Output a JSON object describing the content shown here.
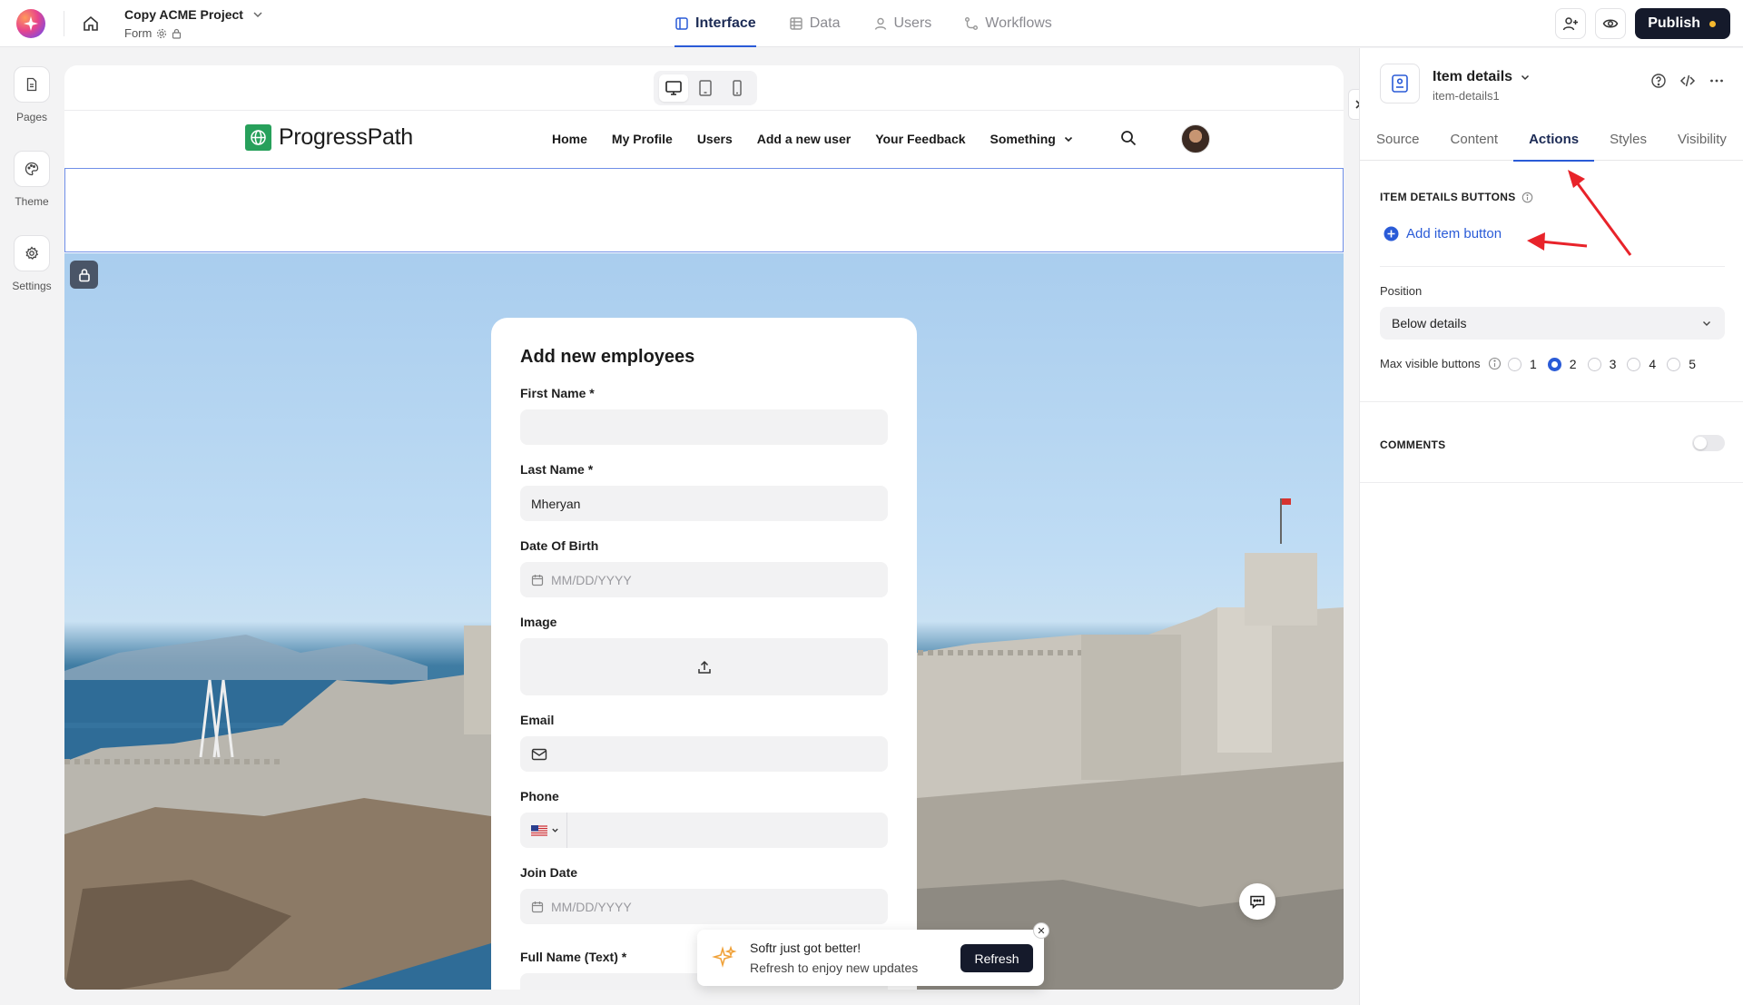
{
  "topbar": {
    "project_name": "Copy ACME Project",
    "page_name": "Form",
    "tabs": [
      {
        "label": "Interface",
        "icon": "layout-icon",
        "active": true
      },
      {
        "label": "Data",
        "icon": "table-icon",
        "active": false
      },
      {
        "label": "Users",
        "icon": "user-icon",
        "active": false
      },
      {
        "label": "Workflows",
        "icon": "workflow-icon",
        "active": false
      }
    ],
    "publish_label": "Publish"
  },
  "rail": {
    "items": [
      {
        "label": "Pages",
        "icon": "page-icon"
      },
      {
        "label": "Theme",
        "icon": "palette-icon"
      },
      {
        "label": "Settings",
        "icon": "gear-icon"
      }
    ]
  },
  "site": {
    "brand": "ProgressPath",
    "nav": [
      "Home",
      "My Profile",
      "Users",
      "Add a new user",
      "Your Feedback",
      "Something"
    ]
  },
  "form": {
    "title": "Add new employees",
    "fields": [
      {
        "label": "First Name *",
        "value": "",
        "placeholder": ""
      },
      {
        "label": "Last Name *",
        "value": "Mheryan",
        "placeholder": ""
      },
      {
        "label": "Date Of Birth",
        "value": "",
        "placeholder": "MM/DD/YYYY"
      },
      {
        "label": "Image",
        "value": "",
        "placeholder": ""
      },
      {
        "label": "Email",
        "value": "",
        "placeholder": ""
      },
      {
        "label": "Phone",
        "value": "",
        "placeholder": ""
      },
      {
        "label": "Join Date",
        "value": "",
        "placeholder": "MM/DD/YYYY"
      },
      {
        "label": "Full Name (Text) *",
        "value": "",
        "placeholder": ""
      }
    ]
  },
  "toast": {
    "title": "Softr just got better!",
    "subtitle": "Refresh to enjoy new updates",
    "button": "Refresh"
  },
  "panel": {
    "block_title": "Item details",
    "block_id": "item-details1",
    "tabs": [
      "Source",
      "Content",
      "Actions",
      "Styles",
      "Visibility"
    ],
    "active_tab": "Actions",
    "buttons_section": "ITEM DETAILS BUTTONS",
    "add_button": "Add item button",
    "position_label": "Position",
    "position_value": "Below details",
    "max_visible_label": "Max visible buttons",
    "max_visible_options": [
      "1",
      "2",
      "3",
      "4",
      "5"
    ],
    "max_visible_selected": "2",
    "comments_label": "COMMENTS",
    "comments_enabled": false
  },
  "colors": {
    "accent": "#2a5bd7",
    "publish_bg": "#151a2b",
    "brand_green": "#27a05b",
    "annotation_arrow": "#e8232a"
  }
}
